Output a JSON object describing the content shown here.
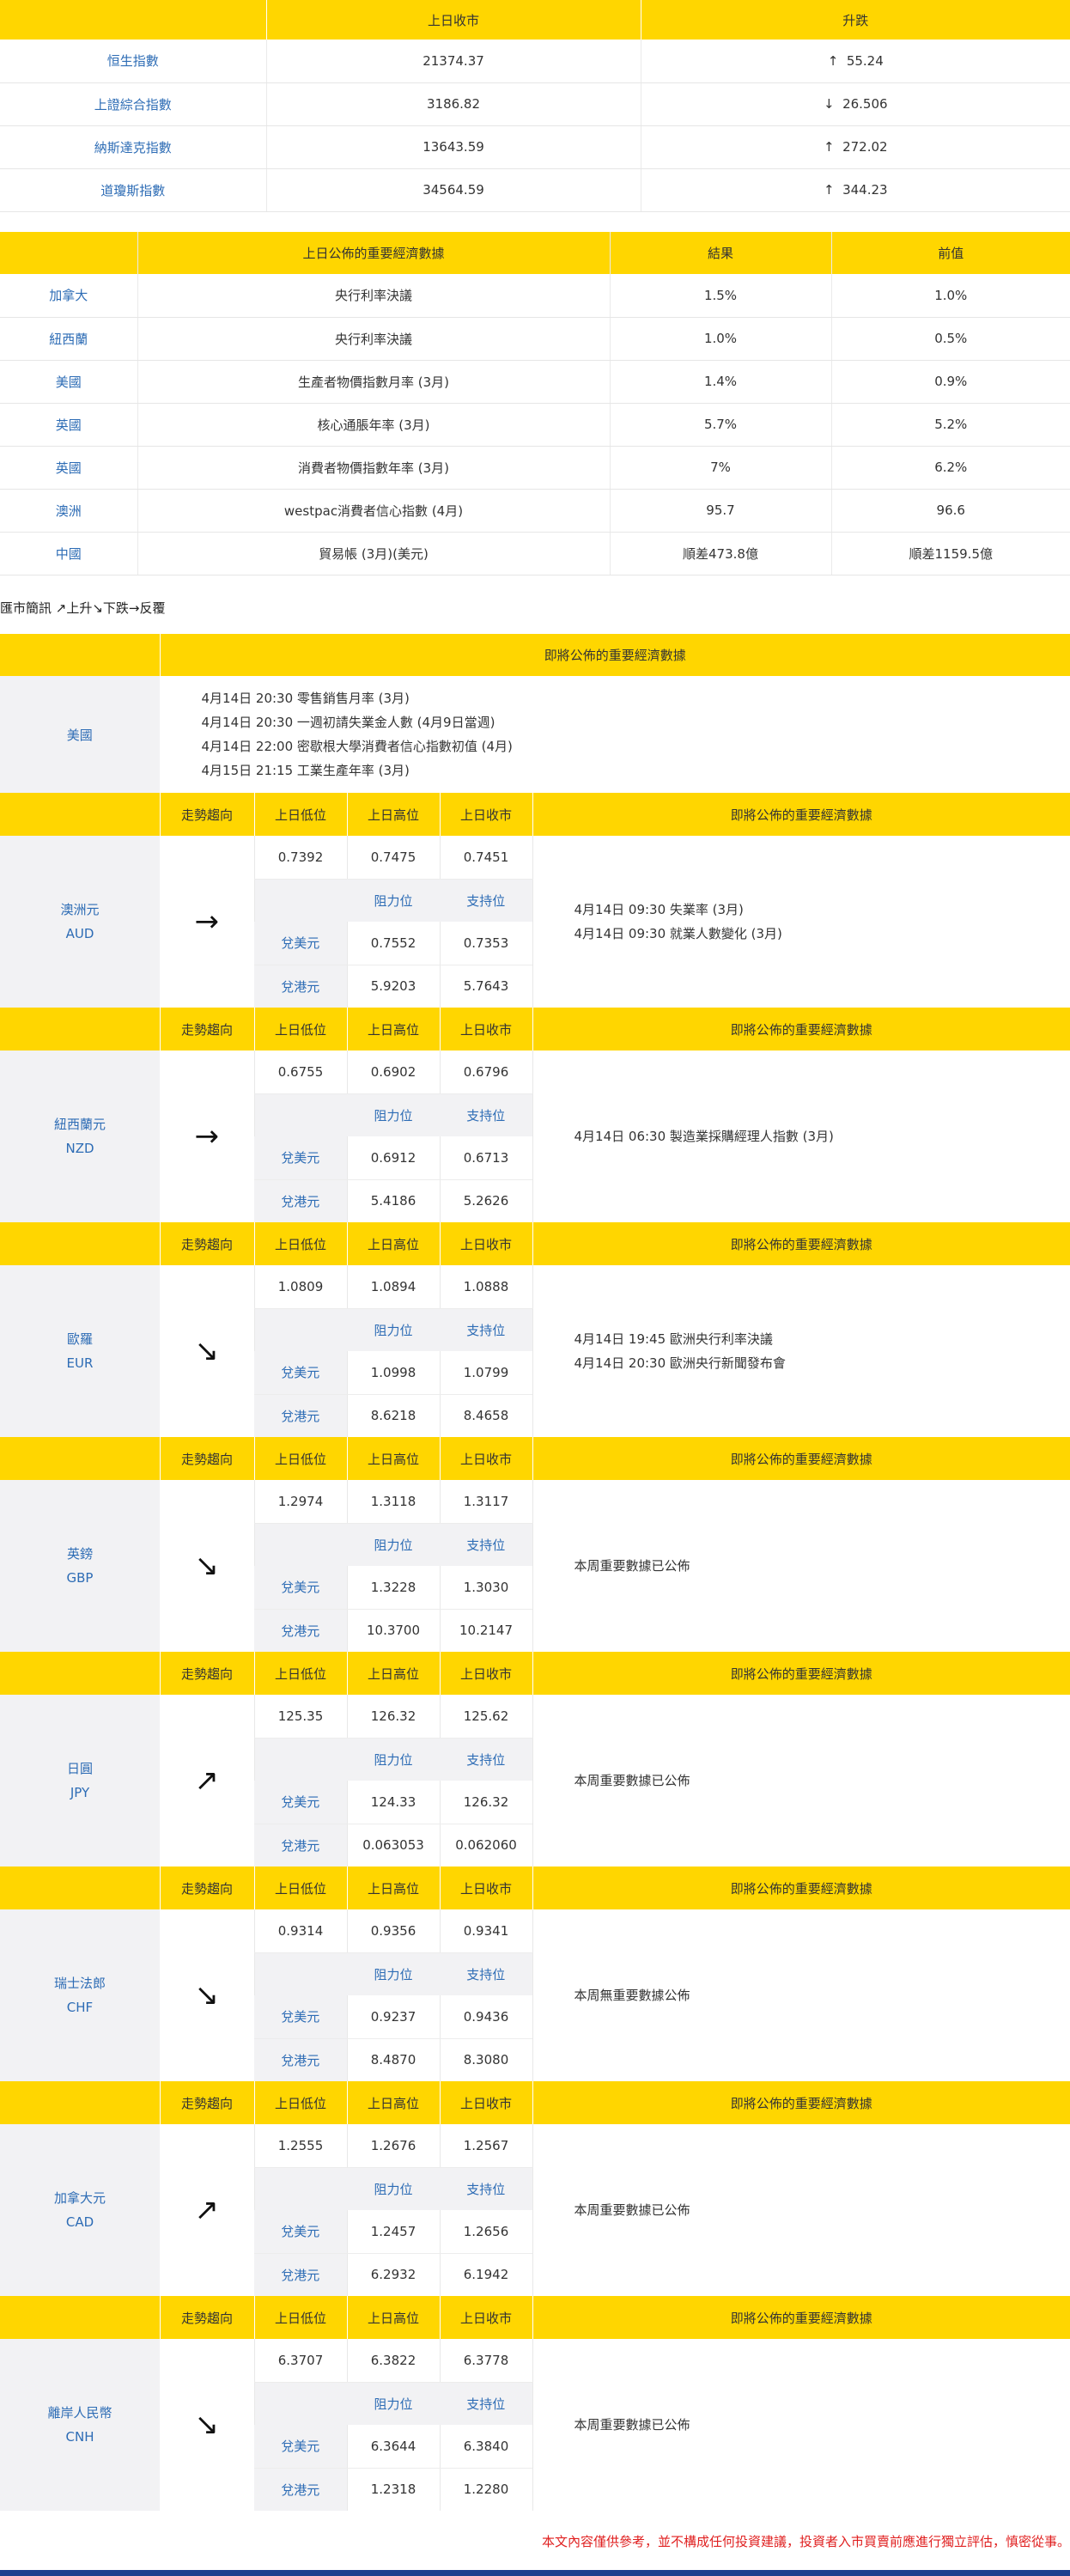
{
  "indices": {
    "headers": [
      "",
      "上日收市",
      "升跌"
    ],
    "rows": [
      {
        "name": "恒生指數",
        "close": "21374.37",
        "arrow": "↑",
        "change": "55.24"
      },
      {
        "name": "上證綜合指數",
        "close": "3186.82",
        "arrow": "↓",
        "change": "26.506"
      },
      {
        "name": "納斯達克指數",
        "close": "13643.59",
        "arrow": "↑",
        "change": "272.02"
      },
      {
        "name": "道瓊斯指數",
        "close": "34564.59",
        "arrow": "↑",
        "change": "344.23"
      }
    ]
  },
  "economic": {
    "headers": [
      "",
      "上日公佈的重要經濟數據",
      "結果",
      "前值"
    ],
    "rows": [
      {
        "country": "加拿大",
        "item": "央行利率決議",
        "result": "1.5%",
        "prev": "1.0%"
      },
      {
        "country": "紐西蘭",
        "item": "央行利率決議",
        "result": "1.0%",
        "prev": "0.5%"
      },
      {
        "country": "美國",
        "item": "生產者物價指數月率 (3月)",
        "result": "1.4%",
        "prev": "0.9%"
      },
      {
        "country": "英國",
        "item": "核心通脹年率 (3月)",
        "result": "5.7%",
        "prev": "5.2%"
      },
      {
        "country": "英國",
        "item": "消費者物價指數年率 (3月)",
        "result": "7%",
        "prev": "6.2%"
      },
      {
        "country": "澳洲",
        "item": "westpac消費者信心指數 (4月)",
        "result": "95.7",
        "prev": "96.6"
      },
      {
        "country": "中國",
        "item": "貿易帳 (3月)(美元)",
        "result": "順差473.8億",
        "prev": "順差1159.5億"
      }
    ]
  },
  "legend": "匯市簡訊 ↗上升↘下跌→反覆",
  "us": {
    "header": "即將公佈的重要經濟數據",
    "country": "美國",
    "events": [
      "4月14日 20:30 零售銷售月率 (3月)",
      "4月14日 20:30 一週初請失業金人數 (4月9日當週)",
      "4月14日 22:00 密歇根大學消費者信心指數初值 (4月)",
      "4月15日 21:15 工業生產年率 (3月)"
    ]
  },
  "labels": {
    "trend": "走勢趨向",
    "low": "上日低位",
    "high": "上日高位",
    "close": "上日收市",
    "upcoming": "即將公佈的重要經濟數據",
    "resistance": "阻力位",
    "support": "支持位",
    "vs_usd": "兌美元",
    "vs_hkd": "兌港元"
  },
  "currencies": [
    {
      "name": "澳洲元",
      "code": "AUD",
      "arrow": "→",
      "low": "0.7392",
      "high": "0.7475",
      "close": "0.7451",
      "usd_res": "0.7552",
      "usd_sup": "0.7353",
      "hkd_res": "5.9203",
      "hkd_sup": "5.7643",
      "events": [
        "4月14日 09:30 失業率 (3月)",
        "4月14日 09:30 就業人數變化 (3月)"
      ]
    },
    {
      "name": "紐西蘭元",
      "code": "NZD",
      "arrow": "→",
      "low": "0.6755",
      "high": "0.6902",
      "close": "0.6796",
      "usd_res": "0.6912",
      "usd_sup": "0.6713",
      "hkd_res": "5.4186",
      "hkd_sup": "5.2626",
      "events": [
        "4月14日 06:30 製造業採購經理人指數 (3月)"
      ]
    },
    {
      "name": "歐羅",
      "code": "EUR",
      "arrow": "↘",
      "low": "1.0809",
      "high": "1.0894",
      "close": "1.0888",
      "usd_res": "1.0998",
      "usd_sup": "1.0799",
      "hkd_res": "8.6218",
      "hkd_sup": "8.4658",
      "events": [
        "4月14日 19:45 歐洲央行利率決議",
        "4月14日 20:30 歐洲央行新聞發布會"
      ]
    },
    {
      "name": "英鎊",
      "code": "GBP",
      "arrow": "↘",
      "low": "1.2974",
      "high": "1.3118",
      "close": "1.3117",
      "usd_res": "1.3228",
      "usd_sup": "1.3030",
      "hkd_res": "10.3700",
      "hkd_sup": "10.2147",
      "events": [
        "本周重要數據已公佈"
      ]
    },
    {
      "name": "日圓",
      "code": "JPY",
      "arrow": "↗",
      "low": "125.35",
      "high": "126.32",
      "close": "125.62",
      "usd_res": "124.33",
      "usd_sup": "126.32",
      "hkd_res": "0.063053",
      "hkd_sup": "0.062060",
      "events": [
        "本周重要數據已公佈"
      ]
    },
    {
      "name": "瑞士法郎",
      "code": "CHF",
      "arrow": "↘",
      "low": "0.9314",
      "high": "0.9356",
      "close": "0.9341",
      "usd_res": "0.9237",
      "usd_sup": "0.9436",
      "hkd_res": "8.4870",
      "hkd_sup": "8.3080",
      "events": [
        "本周無重要數據公佈"
      ]
    },
    {
      "name": "加拿大元",
      "code": "CAD",
      "arrow": "↗",
      "low": "1.2555",
      "high": "1.2676",
      "close": "1.2567",
      "usd_res": "1.2457",
      "usd_sup": "1.2656",
      "hkd_res": "6.2932",
      "hkd_sup": "6.1942",
      "events": [
        "本周重要數據已公佈"
      ]
    },
    {
      "name": "離岸人民幣",
      "code": "CNH",
      "arrow": "↘",
      "low": "6.3707",
      "high": "6.3822",
      "close": "6.3778",
      "usd_res": "6.3644",
      "usd_sup": "6.3840",
      "hkd_res": "1.2318",
      "hkd_sup": "1.2280",
      "events": [
        "本周重要數據已公佈"
      ]
    }
  ],
  "disclaimer": "本文內容僅供參考，並不構成任何投資建議，投資者入市買賣前應進行獨立評估，慎密從事。"
}
